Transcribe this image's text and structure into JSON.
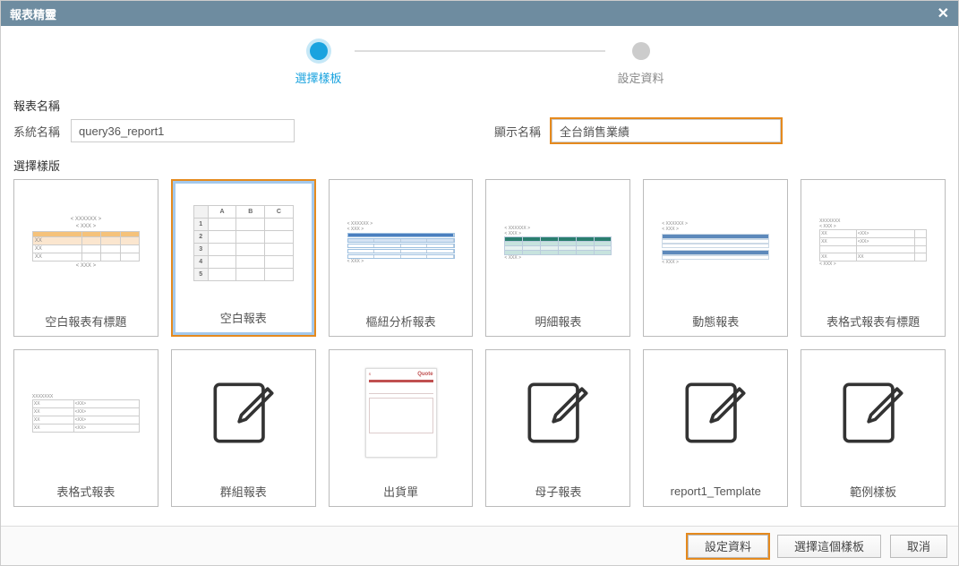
{
  "title": "報表精靈",
  "stepper": {
    "step1": "選擇樣板",
    "step2": "設定資料"
  },
  "labels": {
    "report_name_section": "報表名稱",
    "system_name": "系統名稱",
    "display_name": "顯示名稱",
    "choose_template_section": "選擇樣版"
  },
  "fields": {
    "system_name_value": "query36_report1",
    "display_name_value": "全台銷售業績"
  },
  "templates": [
    {
      "caption": "空白報表有標題"
    },
    {
      "caption": "空白報表"
    },
    {
      "caption": "樞紐分析報表"
    },
    {
      "caption": "明細報表"
    },
    {
      "caption": "動態報表"
    },
    {
      "caption": "表格式報表有標題"
    },
    {
      "caption": "表格式報表"
    },
    {
      "caption": "群組報表"
    },
    {
      "caption": "出貨單"
    },
    {
      "caption": "母子報表"
    },
    {
      "caption": "report1_Template"
    },
    {
      "caption": "範例樣板"
    }
  ],
  "footer": {
    "set_data": "設定資料",
    "choose_this_template": "選擇這個樣板",
    "cancel": "取消"
  }
}
